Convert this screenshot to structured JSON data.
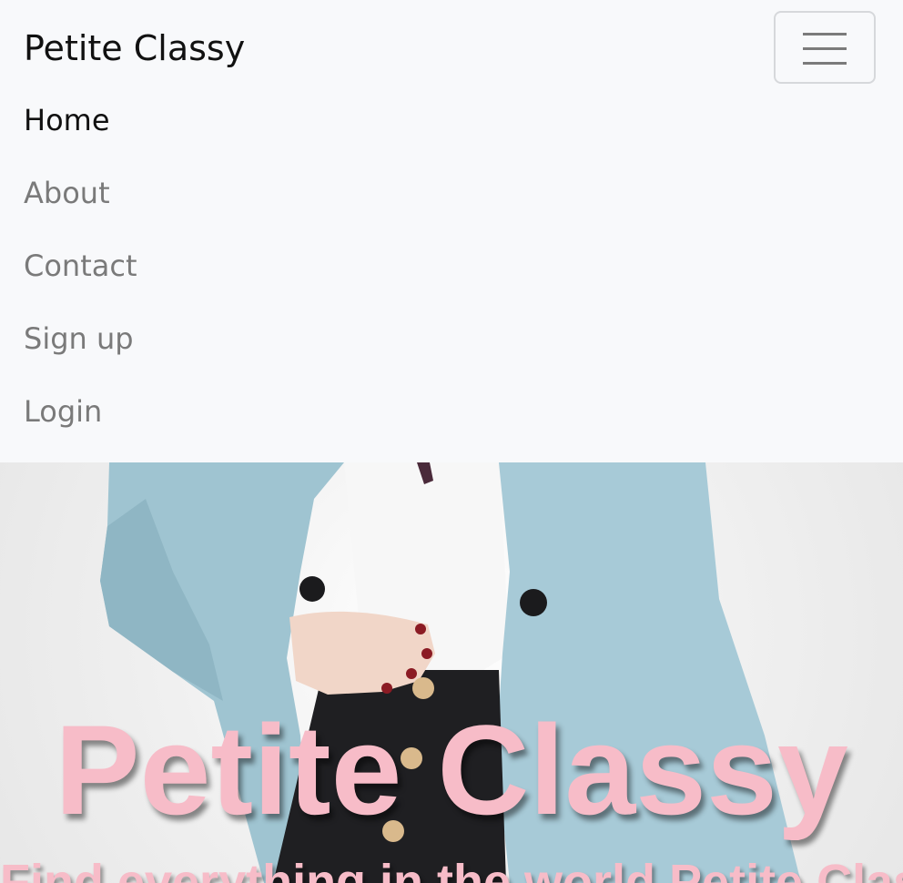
{
  "navbar": {
    "brand": "Petite Classy",
    "toggler_icon": "hamburger-icon",
    "items": [
      {
        "label": "Home",
        "active": true
      },
      {
        "label": "About",
        "active": false
      },
      {
        "label": "Contact",
        "active": false
      },
      {
        "label": "Sign up",
        "active": false
      },
      {
        "label": "Login",
        "active": false
      }
    ]
  },
  "hero": {
    "title": "Petite Classy",
    "subtitle": "Find everything in the world Petite Classy",
    "image": "woman-in-light-blue-coat-photo"
  },
  "colors": {
    "accent_pink": "#f7bcc8",
    "navbar_bg": "#f8f9fb",
    "coat_blue": "#9fc4d1",
    "skirt_black": "#1f1f22"
  }
}
